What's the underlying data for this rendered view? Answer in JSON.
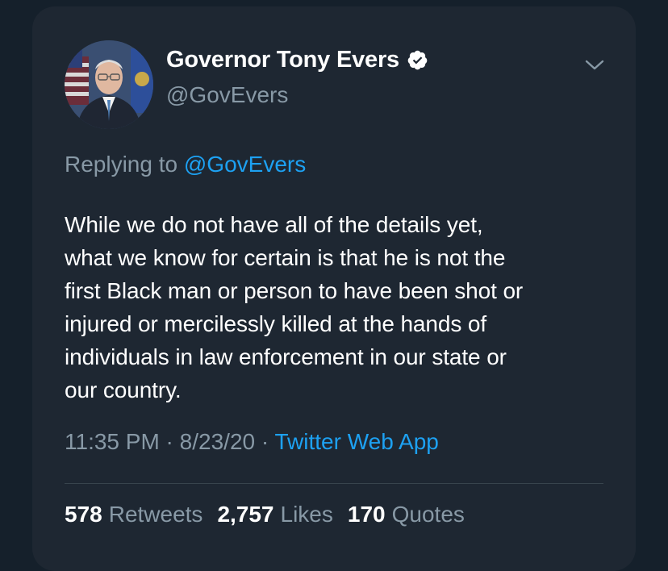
{
  "tweet": {
    "author": {
      "display_name": "Governor Tony Evers",
      "handle": "@GovEvers",
      "verified": true
    },
    "reply": {
      "prefix": "Replying to",
      "mention": "@GovEvers"
    },
    "text_lines": [
      "While we do not have all of the details yet,",
      "what we know for certain is that he is not the",
      "first Black man or person to have been shot or",
      "injured or mercilessly killed at the hands of",
      "individuals in law enforcement in our state or",
      "our country."
    ],
    "meta": {
      "time": "11:35 PM",
      "separator1": " · ",
      "date": "8/23/20",
      "separator2": " · ",
      "source": "Twitter Web App"
    },
    "stats": {
      "retweets_count": "578",
      "retweets_label": "Retweets",
      "likes_count": "2,757",
      "likes_label": "Likes",
      "quotes_count": "170",
      "quotes_label": "Quotes"
    }
  },
  "icons": {
    "verified": "verified-badge-icon",
    "caret": "chevron-down-icon"
  },
  "colors": {
    "background": "#15202b",
    "card": "#1e2732",
    "text": "#ffffff",
    "secondary": "#8899a6",
    "accent": "#1da1f2",
    "divider": "#38444d"
  }
}
